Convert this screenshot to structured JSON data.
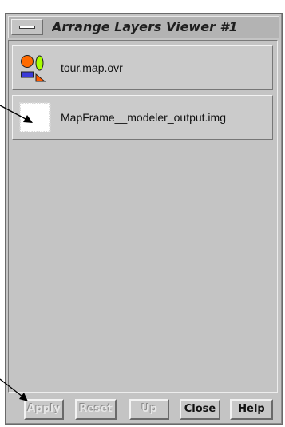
{
  "window": {
    "title": "Arrange Layers Viewer #1"
  },
  "layers": [
    {
      "name": "tour.map.ovr",
      "icon": "vector-annotation-icon"
    },
    {
      "name": "MapFrame__modeler_output.img",
      "icon": "raster-image-icon"
    }
  ],
  "buttons": {
    "apply": "Apply",
    "reset": "Reset",
    "up": "Up",
    "close": "Close",
    "help": "Help"
  },
  "colors": {
    "annotation_circle": "#ff6a00",
    "annotation_ellipse": "#a8ff00",
    "annotation_rect": "#3a3ad8",
    "annotation_triangle": "#ff5a00"
  }
}
